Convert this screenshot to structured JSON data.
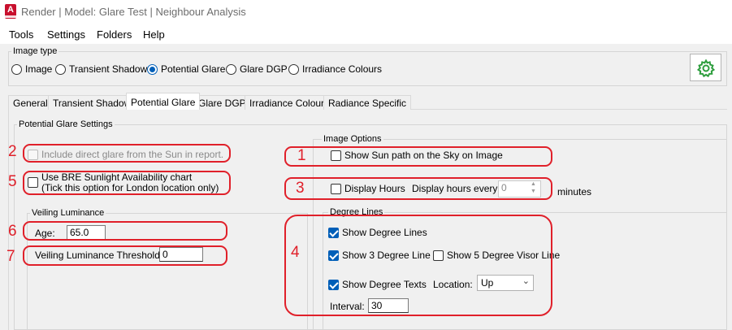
{
  "window": {
    "title": "Render | Model: Glare Test | Neighbour Analysis",
    "app_icon_letter": "A",
    "accent_color": "#c8102e"
  },
  "menu": [
    "Tools",
    "Settings",
    "Folders",
    "Help"
  ],
  "image_type": {
    "label": "Image type",
    "options": [
      "Image",
      "Transient Shadow",
      "Potential Glare",
      "Glare DGP",
      "Irradiance Colours"
    ],
    "selected": "Potential Glare",
    "settings_icon": "gear-icon",
    "settings_icon_color": "#2e9e3e"
  },
  "tabs": [
    "General",
    "Transient Shadow",
    "Potential Glare",
    "Glare DGP",
    "Irradiance Colours",
    "Radiance Specific"
  ],
  "active_tab": "Potential Glare",
  "potential_glare": {
    "group_label": "Potential Glare Settings",
    "include_direct_glare": {
      "label": "Include direct glare from the Sun in report.",
      "checked": false,
      "enabled": false
    },
    "use_bre": {
      "label_line1": "Use BRE Sunlight Availability chart",
      "label_line2": "(Tick this option for London location only)",
      "checked": false
    },
    "veiling": {
      "group_label": "Veiling Luminance",
      "age_label": "Age:",
      "age_value": "65.0",
      "threshold_label": "Veiling Luminance Threshold:",
      "threshold_value": "0"
    },
    "image_options": {
      "group_label": "Image Options",
      "show_sun_path": {
        "label": "Show Sun path on the Sky on Image",
        "checked": false
      },
      "display_hours": {
        "label": "Display Hours",
        "checked": false
      },
      "display_every_label": "Display hours every:",
      "display_every_value": "0",
      "minutes_label": "minutes",
      "degree_lines": {
        "group_label": "Degree Lines",
        "show_degree_lines": {
          "label": "Show Degree Lines",
          "checked": true
        },
        "show_3_degree": {
          "label": "Show 3 Degree Line",
          "checked": true
        },
        "show_5_degree": {
          "label": "Show 5 Degree Visor Line",
          "checked": false
        },
        "show_degree_texts": {
          "label": "Show Degree Texts",
          "checked": true
        },
        "location_label": "Location:",
        "location_value": "Up",
        "interval_label": "Interval:",
        "interval_value": "30"
      }
    }
  },
  "annotations": {
    "color": "#e0202a",
    "labels": [
      "1",
      "2",
      "3",
      "4",
      "5",
      "6",
      "7"
    ]
  }
}
